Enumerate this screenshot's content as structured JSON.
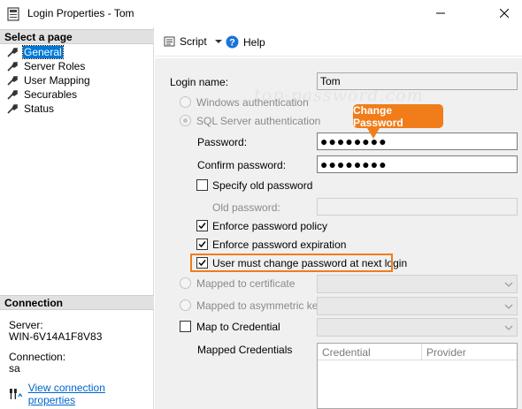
{
  "window": {
    "title": "Login Properties - Tom"
  },
  "left": {
    "select_page_header": "Select a page",
    "pages": [
      {
        "label": "General",
        "selected": true
      },
      {
        "label": "Server Roles",
        "selected": false
      },
      {
        "label": "User Mapping",
        "selected": false
      },
      {
        "label": "Securables",
        "selected": false
      },
      {
        "label": "Status",
        "selected": false
      }
    ],
    "connection_header": "Connection",
    "server_label": "Server:",
    "server_value": "WIN-6V14A1F8V83",
    "connection_label": "Connection:",
    "connection_value": "sa",
    "view_link": "View connection properties"
  },
  "toolbar": {
    "script_label": "Script",
    "help_label": "Help"
  },
  "form": {
    "login_name_label": "Login name:",
    "login_name_value": "Tom",
    "windows_auth_label": "Windows authentication",
    "sql_auth_label": "SQL Server authentication",
    "password_label": "Password:",
    "password_value": "●●●●●●●●",
    "confirm_label": "Confirm password:",
    "confirm_value": "●●●●●●●●",
    "specify_old_label": "Specify old password",
    "old_password_label": "Old password:",
    "enforce_policy_label": "Enforce password policy",
    "enforce_expiration_label": "Enforce password expiration",
    "must_change_label": "User must change password at next login",
    "mapped_cert_label": "Mapped to certificate",
    "mapped_asym_label": "Mapped to asymmetric key",
    "map_credential_label": "Map to Credential",
    "mapped_credentials_label": "Mapped Credentials",
    "grid_headers": [
      "Credential",
      "Provider"
    ]
  },
  "overlay": {
    "watermark": "top-password.com",
    "callout_text": "Change Password",
    "accent_color": "#f07d1a"
  }
}
